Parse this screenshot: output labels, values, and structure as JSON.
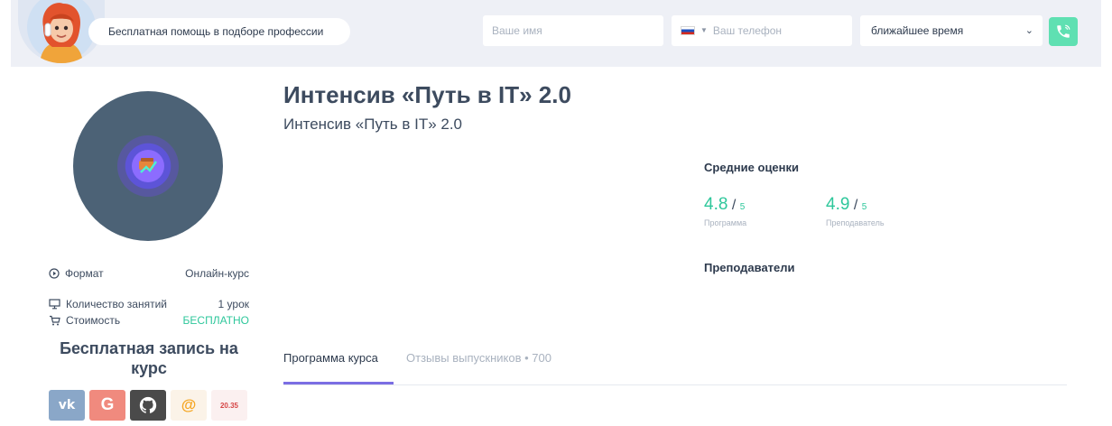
{
  "header": {
    "helper_text": "Бесплатная помощь в подборе профессии",
    "name_placeholder": "Ваше имя",
    "phone_placeholder": "Ваш телефон",
    "time_value": "ближайшее время",
    "call_icon": "phone-call-icon"
  },
  "course": {
    "title": "Интенсив «Путь в IT» 2.0",
    "subtitle": "Интенсив «Путь в IT» 2.0"
  },
  "info": {
    "format_label": "Формат",
    "format_value": "Онлайн-курс",
    "lessons_label": "Количество занятий",
    "lessons_value": "1 урок",
    "price_label": "Стоимость",
    "price_value": "БЕСПЛАТНО"
  },
  "signup": {
    "title": "Бесплатная запись на курс"
  },
  "social": [
    {
      "label": "vk",
      "color": "#8aa7c8"
    },
    {
      "label": "G",
      "color": "#f08a7e"
    },
    {
      "label": "github",
      "color": "#4a4a4a"
    },
    {
      "label": "@",
      "color": "#f9f1e4"
    },
    {
      "label": "20.35",
      "color": "#fbeeee"
    }
  ],
  "ratings": {
    "header": "Средние оценки",
    "items": [
      {
        "value": "4.8",
        "slash": "/",
        "max": "5",
        "caption": "Программа"
      },
      {
        "value": "4.9",
        "slash": "/",
        "max": "5",
        "caption": "Преподаватель"
      }
    ]
  },
  "teachers": {
    "header": "Преподаватели"
  },
  "tabs": [
    {
      "label": "Программа курса",
      "active": true
    },
    {
      "label": "Отзывы выпускников • 700",
      "active": false
    }
  ],
  "colors": {
    "accent_green": "#2ec79b",
    "tab_underline": "#7b6ee3",
    "call_button": "#5fe0b2"
  }
}
